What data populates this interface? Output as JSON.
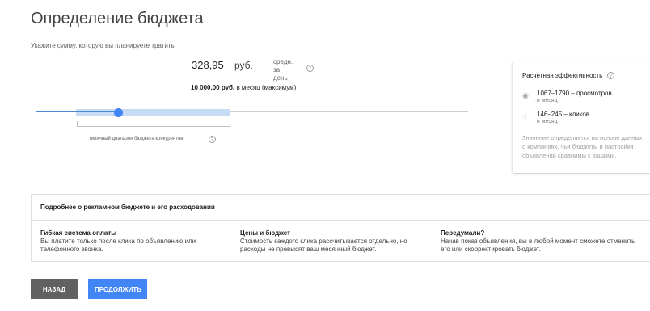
{
  "page": {
    "title": "Определение бюджета",
    "subtitle": "Укажите сумму, которую вы планируете тратить"
  },
  "budget": {
    "amount": "328,95",
    "currency": "руб.",
    "period_line1": "средн.",
    "period_line2": "за день",
    "monthly_value": "10 000,00 руб.",
    "monthly_suffix": " в месяц (максимум)"
  },
  "slider": {
    "value_fraction": 0.19,
    "competitor_range_label": "типичный диапазон бюджета конкурентов"
  },
  "performance": {
    "title": "Расчетная эффективность",
    "views_value": "1067–1790  – просмотров",
    "views_period": "в месяц",
    "clicks_value": "146–245  – кликов",
    "clicks_period": "в месяц",
    "note": "Значение определяется на основе данных о компаниях, чьи бюджеты и настройки объявлений сравнимы с вашими."
  },
  "info": {
    "header": "Подробнее о рекламном бюджете и его расходовании",
    "columns": [
      {
        "title": "Гибкая система оплаты",
        "text": "Вы платите только после клика по объявлению или телефонного звонка."
      },
      {
        "title": "Цены и бюджет",
        "text": "Стоимость каждого клика рассчитывается отдельно, но расходы не превысят ваш месячный бюджет."
      },
      {
        "title": "Передумали?",
        "text": "Начав показ объявления, вы в любой момент сможете отменить его или скорректировать бюджет."
      }
    ]
  },
  "buttons": {
    "back": "НАЗАД",
    "next": "ПРОДОЛЖИТЬ"
  },
  "icons": {
    "help": "help-circle-icon",
    "views": "eye-icon",
    "clicks": "hand-pointer-icon"
  },
  "colors": {
    "accent": "#4285f4",
    "range": "#c6dcf5",
    "back_button": "#616161"
  }
}
